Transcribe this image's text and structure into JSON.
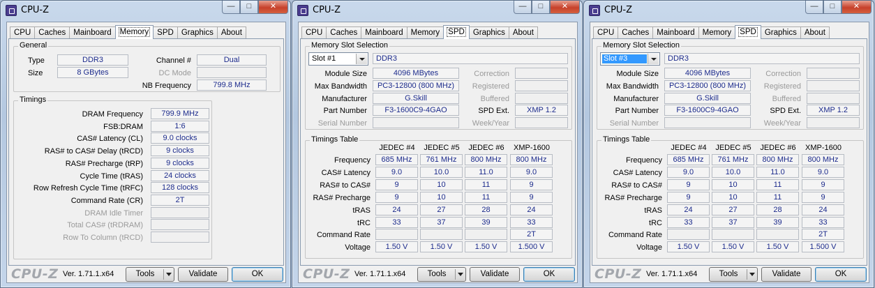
{
  "app": {
    "title": "CPU-Z",
    "brand": "CPU-Z",
    "version": "Ver. 1.71.1.x64",
    "tools_label": "Tools",
    "validate_label": "Validate",
    "ok_label": "OK",
    "tabs": [
      "CPU",
      "Caches",
      "Mainboard",
      "Memory",
      "SPD",
      "Graphics",
      "About"
    ],
    "window_controls": {
      "minimize": "—",
      "maximize": "□",
      "close": "✕"
    }
  },
  "memory": {
    "general": {
      "title": "General",
      "type_label": "Type",
      "type": "DDR3",
      "size_label": "Size",
      "size": "8 GBytes",
      "channel_label": "Channel #",
      "channel": "Dual",
      "dc_mode_label": "DC Mode",
      "dc_mode": "",
      "nb_freq_label": "NB Frequency",
      "nb_freq": "799.8 MHz"
    },
    "timings": {
      "title": "Timings",
      "rows": [
        {
          "label": "DRAM Frequency",
          "value": "799.9 MHz",
          "disabled": false
        },
        {
          "label": "FSB:DRAM",
          "value": "1:6",
          "disabled": false
        },
        {
          "label": "CAS# Latency (CL)",
          "value": "9.0 clocks",
          "disabled": false
        },
        {
          "label": "RAS# to CAS# Delay (tRCD)",
          "value": "9 clocks",
          "disabled": false
        },
        {
          "label": "RAS# Precharge (tRP)",
          "value": "9 clocks",
          "disabled": false
        },
        {
          "label": "Cycle Time (tRAS)",
          "value": "24 clocks",
          "disabled": false
        },
        {
          "label": "Row Refresh Cycle Time (tRFC)",
          "value": "128 clocks",
          "disabled": false
        },
        {
          "label": "Command Rate (CR)",
          "value": "2T",
          "disabled": false
        },
        {
          "label": "DRAM Idle Timer",
          "value": "",
          "disabled": true
        },
        {
          "label": "Total CAS# (tRDRAM)",
          "value": "",
          "disabled": true
        },
        {
          "label": "Row To Column (tRCD)",
          "value": "",
          "disabled": true
        }
      ]
    }
  },
  "spd_windows": [
    {
      "slot_group_title": "Memory Slot Selection",
      "slot": "Slot #1",
      "slot_selected": false,
      "type": "DDR3",
      "module_size_label": "Module Size",
      "module_size": "4096 MBytes",
      "max_bw_label": "Max Bandwidth",
      "max_bw": "PC3-12800 (800 MHz)",
      "manufacturer_label": "Manufacturer",
      "manufacturer": "G.Skill",
      "part_label": "Part Number",
      "part": "F3-1600C9-4GAO",
      "serial_label": "Serial Number",
      "serial": "",
      "correction_label": "Correction",
      "correction": "",
      "registered_label": "Registered",
      "registered": "",
      "buffered_label": "Buffered",
      "buffered": "",
      "spd_ext_label": "SPD Ext.",
      "spd_ext": "XMP 1.2",
      "week_year_label": "Week/Year",
      "week_year": ""
    },
    {
      "slot_group_title": "Memory Slot Selection",
      "slot": "Slot #3",
      "slot_selected": true,
      "type": "DDR3",
      "module_size_label": "Module Size",
      "module_size": "4096 MBytes",
      "max_bw_label": "Max Bandwidth",
      "max_bw": "PC3-12800 (800 MHz)",
      "manufacturer_label": "Manufacturer",
      "manufacturer": "G.Skill",
      "part_label": "Part Number",
      "part": "F3-1600C9-4GAO",
      "serial_label": "Serial Number",
      "serial": "",
      "correction_label": "Correction",
      "correction": "",
      "registered_label": "Registered",
      "registered": "",
      "buffered_label": "Buffered",
      "buffered": "",
      "spd_ext_label": "SPD Ext.",
      "spd_ext": "XMP 1.2",
      "week_year_label": "Week/Year",
      "week_year": ""
    }
  ],
  "timings_table": {
    "title": "Timings Table",
    "columns": [
      "JEDEC #4",
      "JEDEC #5",
      "JEDEC #6",
      "XMP-1600"
    ],
    "rows": [
      {
        "label": "Frequency",
        "values": [
          "685 MHz",
          "761 MHz",
          "800 MHz",
          "800 MHz"
        ]
      },
      {
        "label": "CAS# Latency",
        "values": [
          "9.0",
          "10.0",
          "11.0",
          "9.0"
        ]
      },
      {
        "label": "RAS# to CAS#",
        "values": [
          "9",
          "10",
          "11",
          "9"
        ]
      },
      {
        "label": "RAS# Precharge",
        "values": [
          "9",
          "10",
          "11",
          "9"
        ]
      },
      {
        "label": "tRAS",
        "values": [
          "24",
          "27",
          "28",
          "24"
        ]
      },
      {
        "label": "tRC",
        "values": [
          "33",
          "37",
          "39",
          "33"
        ]
      },
      {
        "label": "Command Rate",
        "values": [
          "",
          "",
          "",
          "2T"
        ]
      },
      {
        "label": "Voltage",
        "values": [
          "1.50 V",
          "1.50 V",
          "1.50 V",
          "1.500 V"
        ]
      }
    ]
  }
}
